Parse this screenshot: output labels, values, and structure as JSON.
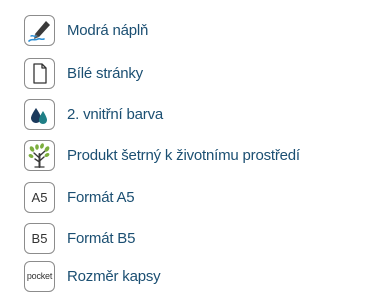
{
  "features": [
    {
      "icon": "pen-icon",
      "label": "Modrá náplň"
    },
    {
      "icon": "page-icon",
      "label": "Bílé stránky"
    },
    {
      "icon": "ink-drops-icon",
      "label": "2. vnitřní barva"
    },
    {
      "icon": "tree-icon",
      "label": "Produkt šetrný k životnímu prostředí"
    },
    {
      "icon": "format-a5-icon",
      "icon_text": "A5",
      "label": "Formát A5"
    },
    {
      "icon": "format-b5-icon",
      "icon_text": "B5",
      "label": "Formát B5"
    },
    {
      "icon": "pocket-size-icon",
      "icon_text": "pocket",
      "label": "Rozměr kapsy"
    }
  ],
  "colors": {
    "label": "#1b4f72",
    "icon_border": "#8c8c8c",
    "pen_ink": "#2a8fd6",
    "drop_dark": "#1b3a5c",
    "drop_teal": "#1f7f86"
  }
}
